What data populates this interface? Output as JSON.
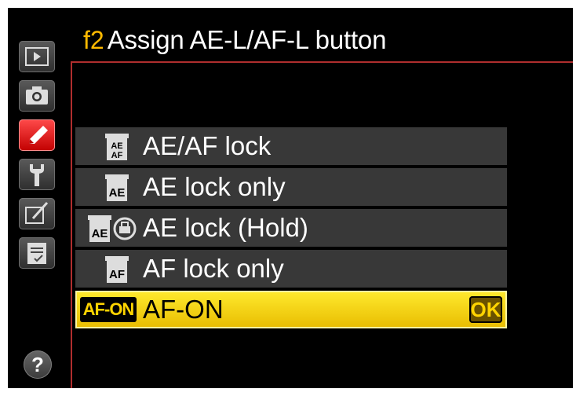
{
  "header": {
    "code": "f2",
    "title": "Assign AE-L/AF-L button"
  },
  "sidebar": {
    "items": [
      {
        "name": "playback-menu",
        "icon": "playback-icon",
        "active": false
      },
      {
        "name": "shooting-menu",
        "icon": "camera-icon",
        "active": false
      },
      {
        "name": "custom-settings-menu",
        "icon": "pencil-icon",
        "active": true
      },
      {
        "name": "setup-menu",
        "icon": "wrench-icon",
        "active": false
      },
      {
        "name": "retouch-menu",
        "icon": "retouch-icon",
        "active": false
      },
      {
        "name": "my-menu",
        "icon": "recent-settings-icon",
        "active": false
      }
    ],
    "help": "?"
  },
  "options": [
    {
      "label": "AE/AF lock",
      "icon": "ae-af-lock-icon",
      "selected": false
    },
    {
      "label": "AE lock only",
      "icon": "ae-lock-icon",
      "selected": false
    },
    {
      "label": "AE lock (Hold)",
      "icon": "ae-lock-hold-icon",
      "selected": false
    },
    {
      "label": "AF lock only",
      "icon": "af-lock-icon",
      "selected": false
    },
    {
      "label": "AF-ON",
      "icon": "af-on-icon",
      "badge": "AF-ON",
      "selected": true,
      "confirm": "OK"
    }
  ],
  "colors": {
    "accent": "#ffba00",
    "selected_bg": "#f5d000",
    "item_bg": "#383838",
    "frame": "#b02e2e"
  }
}
